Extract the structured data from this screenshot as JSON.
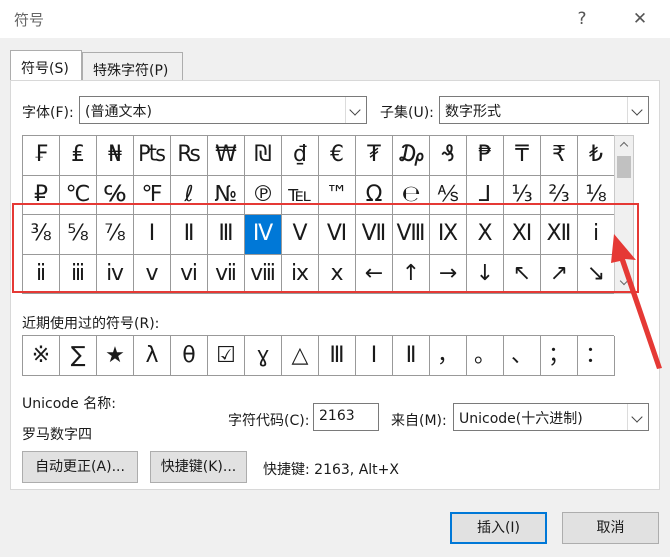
{
  "window": {
    "title": "符号",
    "help_label": "?",
    "close_label": "✕"
  },
  "tabs": [
    {
      "label": "符号(S)"
    },
    {
      "label": "特殊字符(P)"
    }
  ],
  "font": {
    "label": "字体(F):",
    "value": "(普通文本)"
  },
  "subset": {
    "label": "子集(U):",
    "value": "数字形式"
  },
  "symbol_grid": {
    "rows": [
      [
        "₣",
        "₤",
        "₦",
        "₧",
        "₨",
        "₩",
        "₪",
        "₫",
        "€",
        "₮",
        "₯",
        "₰",
        "₱",
        "₸",
        "₹",
        "₺"
      ],
      [
        "₽",
        "℃",
        "℅",
        "℉",
        "ℓ",
        "№",
        "℗",
        "℡",
        "™",
        "Ω",
        "℮",
        "⅍",
        "⅃",
        "⅓",
        "⅔",
        "⅛"
      ],
      [
        "⅜",
        "⅝",
        "⅞",
        "Ⅰ",
        "Ⅱ",
        "Ⅲ",
        "Ⅳ",
        "Ⅴ",
        "Ⅵ",
        "Ⅶ",
        "Ⅷ",
        "Ⅸ",
        "Ⅹ",
        "Ⅺ",
        "Ⅻ",
        "ⅰ"
      ],
      [
        "ⅱ",
        "ⅲ",
        "ⅳ",
        "ⅴ",
        "ⅵ",
        "ⅶ",
        "ⅷ",
        "ⅸ",
        "ⅹ",
        "←",
        "↑",
        "→",
        "↓",
        "↖",
        "↗",
        "↘"
      ]
    ],
    "selected": "Ⅳ"
  },
  "recent": {
    "label": "近期使用过的符号(R):",
    "symbols": [
      "※",
      "∑",
      "★",
      "λ",
      "θ",
      "☑",
      "ɣ",
      "△",
      "Ⅲ",
      "Ⅰ",
      "Ⅱ",
      "，",
      "。",
      "、",
      "；",
      "："
    ]
  },
  "unicode_name": {
    "label": "Unicode 名称:",
    "value": "罗马数字四"
  },
  "char_code": {
    "label": "字符代码(C):",
    "value": "2163"
  },
  "from": {
    "label": "来自(M):",
    "value": "Unicode(十六进制)"
  },
  "buttons": {
    "autocorrect": "自动更正(A)...",
    "shortcut_key": "快捷键(K)...",
    "insert": "插入(I)",
    "cancel": "取消"
  },
  "shortcut_text": "快捷键: 2163, Alt+X",
  "colors": {
    "selection": "#0078d7",
    "annotation": "#e53935"
  }
}
